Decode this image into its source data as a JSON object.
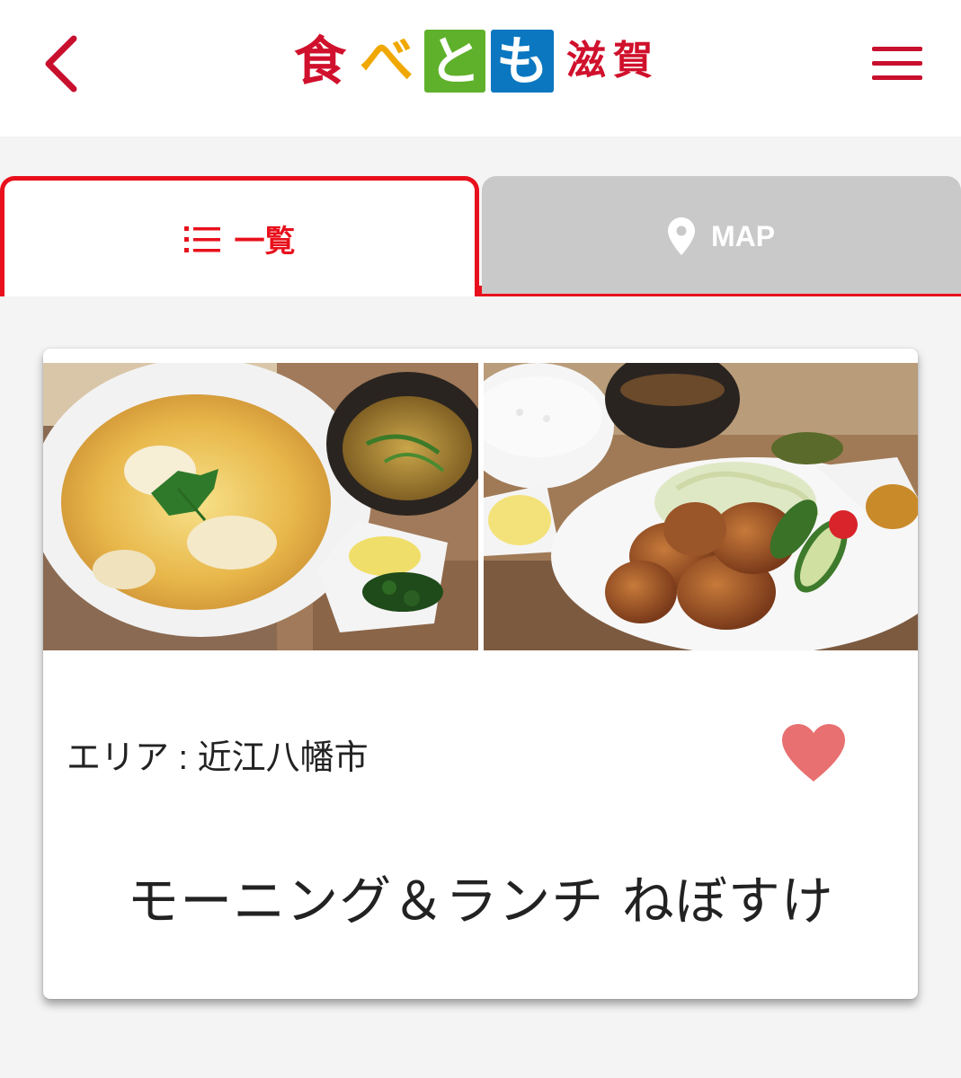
{
  "header": {
    "back_icon": "chevron-left-icon",
    "menu_icon": "hamburger-menu-icon",
    "logo": {
      "chars": [
        "食",
        "べ",
        "と",
        "も"
      ],
      "region": "滋賀",
      "colors": {
        "red": "#d0102c",
        "yellow": "#f0a800",
        "green": "#5fb12b",
        "blue": "#0a77c0"
      }
    }
  },
  "tabs": {
    "list": {
      "label": "一覧",
      "icon": "list-icon",
      "active": true
    },
    "map": {
      "label": "MAP",
      "icon": "map-pin-icon",
      "active": false
    },
    "accent_color": "#e8101c",
    "inactive_color": "#c9c9c9"
  },
  "card": {
    "photos": [
      "oyakodon-set-photo",
      "karaage-set-photo"
    ],
    "area": "エリア : 近江八幡市",
    "favorite_icon": "heart-icon",
    "favorite_color": "#e87070",
    "shop_name": "モーニング＆ランチ ねぼすけ"
  }
}
